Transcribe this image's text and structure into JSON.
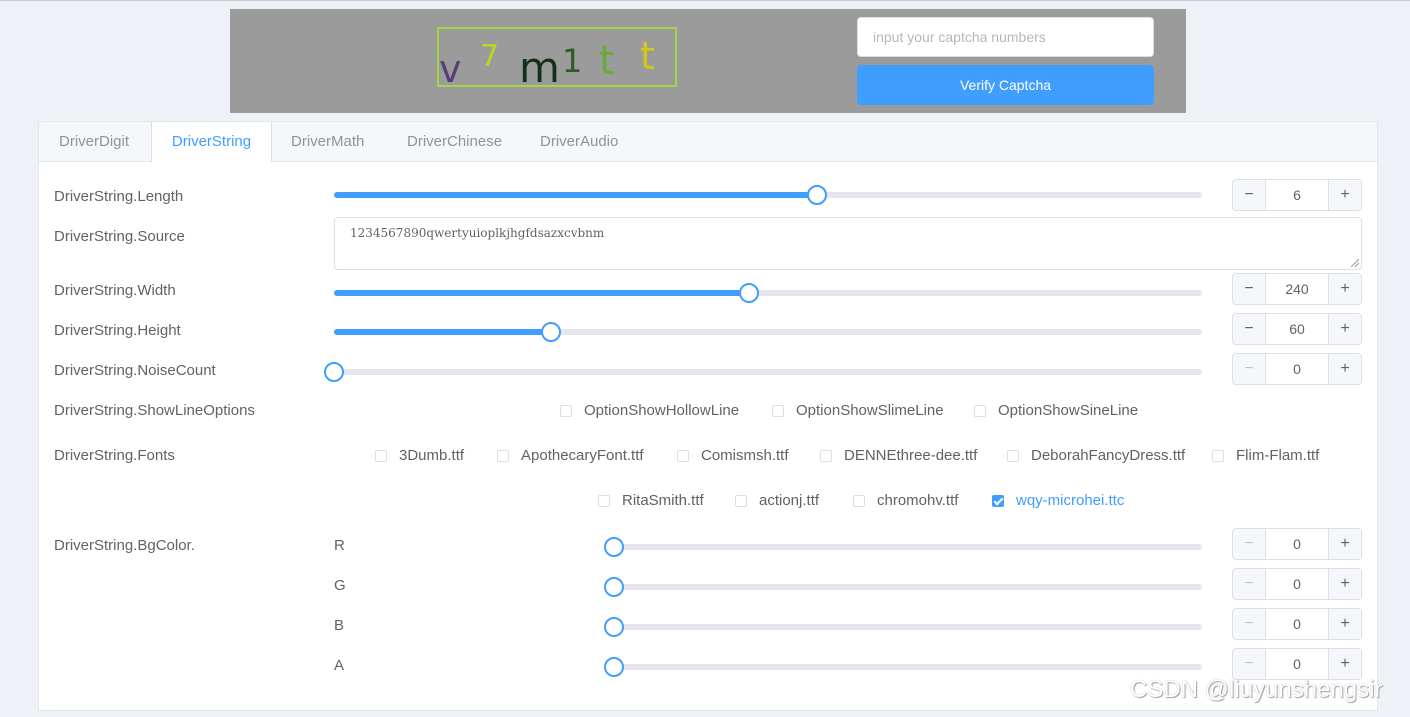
{
  "captcha": {
    "glyphs": [
      {
        "ch": "v",
        "color": "#5a3e7a"
      },
      {
        "ch": "7",
        "color": "#b8d820"
      },
      {
        "ch": "m",
        "color": "#15301a"
      },
      {
        "ch": "1",
        "color": "#2f5a26"
      },
      {
        "ch": "t",
        "color": "#6aaa3a"
      },
      {
        "ch": "t",
        "color": "#d2c81a"
      }
    ],
    "input_placeholder": "input your captcha numbers",
    "input_value": "",
    "verify_label": "Verify Captcha"
  },
  "tabs": [
    {
      "label": "DriverDigit",
      "active": false
    },
    {
      "label": "DriverString",
      "active": true
    },
    {
      "label": "DriverMath",
      "active": false
    },
    {
      "label": "DriverChinese",
      "active": false
    },
    {
      "label": "DriverAudio",
      "active": false
    }
  ],
  "form": {
    "length": {
      "label": "DriverString.Length",
      "value": "6",
      "fraction": 0.556
    },
    "source": {
      "label": "DriverString.Source",
      "value": "1234567890qwertyuioplkjhgfdsazxcvbnm"
    },
    "width": {
      "label": "DriverString.Width",
      "value": "240",
      "fraction": 0.478
    },
    "height": {
      "label": "DriverString.Height",
      "value": "60",
      "fraction": 0.25
    },
    "noise_count": {
      "label": "DriverString.NoiseCount",
      "value": "0",
      "fraction": 0
    },
    "show_line_options": {
      "label": "DriverString.ShowLineOptions",
      "options": [
        {
          "label": "OptionShowHollowLine",
          "checked": false
        },
        {
          "label": "OptionShowSlimeLine",
          "checked": false
        },
        {
          "label": "OptionShowSineLine",
          "checked": false
        }
      ]
    },
    "fonts": {
      "label": "DriverString.Fonts",
      "options": [
        {
          "label": "3Dumb.ttf",
          "checked": false
        },
        {
          "label": "ApothecaryFont.ttf",
          "checked": false
        },
        {
          "label": "Comismsh.ttf",
          "checked": false
        },
        {
          "label": "DENNEthree-dee.ttf",
          "checked": false
        },
        {
          "label": "DeborahFancyDress.ttf",
          "checked": false
        },
        {
          "label": "Flim-Flam.ttf",
          "checked": false
        },
        {
          "label": "RitaSmith.ttf",
          "checked": false
        },
        {
          "label": "actionj.ttf",
          "checked": false
        },
        {
          "label": "chromohv.ttf",
          "checked": false
        },
        {
          "label": "wqy-microhei.ttc",
          "checked": true
        }
      ]
    },
    "bg_color": {
      "label": "DriverString.BgColor.",
      "channels": [
        {
          "label": "R",
          "value": "0",
          "fraction": 0
        },
        {
          "label": "G",
          "value": "0",
          "fraction": 0
        },
        {
          "label": "B",
          "value": "0",
          "fraction": 0
        },
        {
          "label": "A",
          "value": "0",
          "fraction": 0
        }
      ]
    }
  },
  "icons": {
    "minus": "minus-icon",
    "plus": "plus-icon"
  },
  "colors": {
    "primary": "#409eff",
    "captcha_bg": "#9b9b9b",
    "captcha_border": "#a6d449"
  },
  "watermark": "CSDN @liuyunshengsir"
}
